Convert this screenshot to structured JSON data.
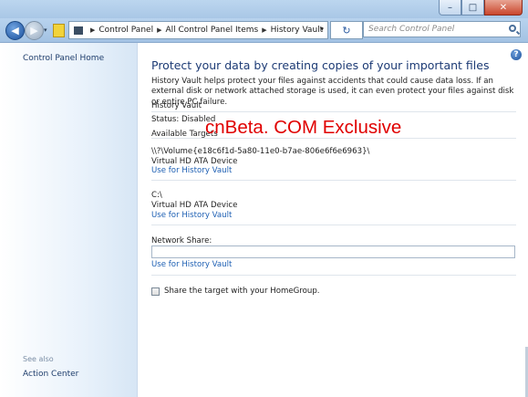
{
  "window": {
    "caption": {
      "minimize": "–",
      "maximize": "□",
      "close": "✕"
    }
  },
  "navbar": {
    "breadcrumbs": [
      "Control Panel",
      "All Control Panel Items",
      "History Vault"
    ],
    "search_placeholder": "Search Control Panel",
    "refresh_glyph": "↻",
    "dropdown_glyph": "▾",
    "separator_glyph": "▶"
  },
  "sidebar": {
    "home_link": "Control Panel Home",
    "see_also_label": "See also",
    "see_also_links": [
      "Action Center"
    ]
  },
  "main": {
    "help_glyph": "?",
    "title": "Protect your data by creating copies of your important files",
    "description": "History Vault helps protect your files against accidents that could cause data loss. If an external disk or network attached storage is used, it can even protect your files against disk or entire PC failure.",
    "section_label": "History Vault",
    "status": "Status: Disabled",
    "available_targets_label": "Available Targets",
    "targets": [
      {
        "path": "\\\\?\\Volume{e18c6f1d-5a80-11e0-b7ae-806e6f6e6963}\\",
        "device": "Virtual HD ATA Device",
        "action": "Use for History Vault"
      },
      {
        "path": "C:\\",
        "device": "Virtual HD ATA Device",
        "action": "Use for History Vault"
      }
    ],
    "network_share_label": "Network Share:",
    "network_share_value": "",
    "network_share_action": "Use for History Vault",
    "homegroup_checkbox_label": "Share the target with your HomeGroup.",
    "homegroup_checked": false,
    "watermark": "cnBeta. COM Exclusive"
  },
  "colors": {
    "link": "#1d5fb3",
    "title": "#1d3b75",
    "watermark": "#e00000",
    "close_button": "#c9462c"
  }
}
